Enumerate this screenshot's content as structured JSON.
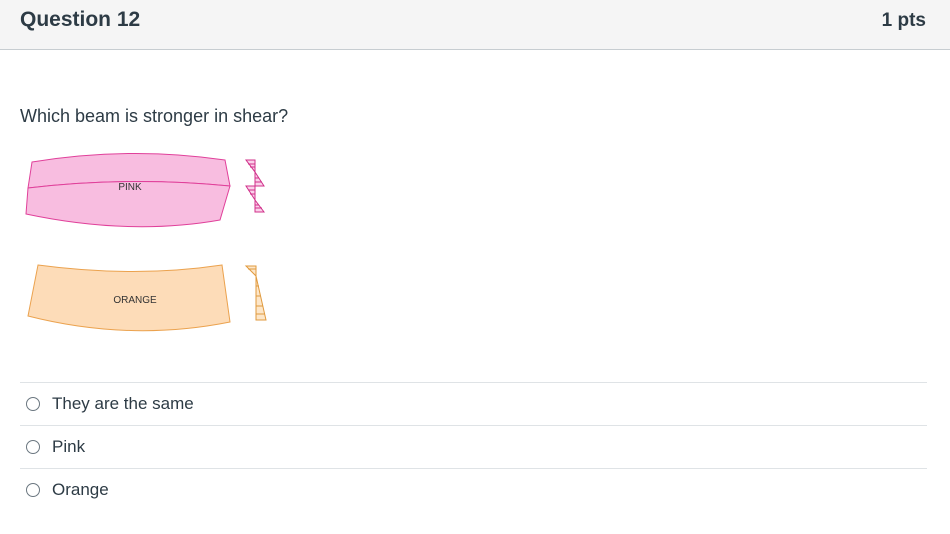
{
  "question": {
    "title": "Question 12",
    "points": "1 pts",
    "text": "Which beam is stronger in shear?"
  },
  "figure": {
    "pink_label": "PINK",
    "orange_label": "ORANGE",
    "pink_fill": "#f8bde0",
    "pink_stroke": "#e0409a",
    "orange_fill": "#fddcb8",
    "orange_stroke": "#eba24e"
  },
  "answers": [
    {
      "label": "They are the same"
    },
    {
      "label": "Pink"
    },
    {
      "label": "Orange"
    }
  ]
}
